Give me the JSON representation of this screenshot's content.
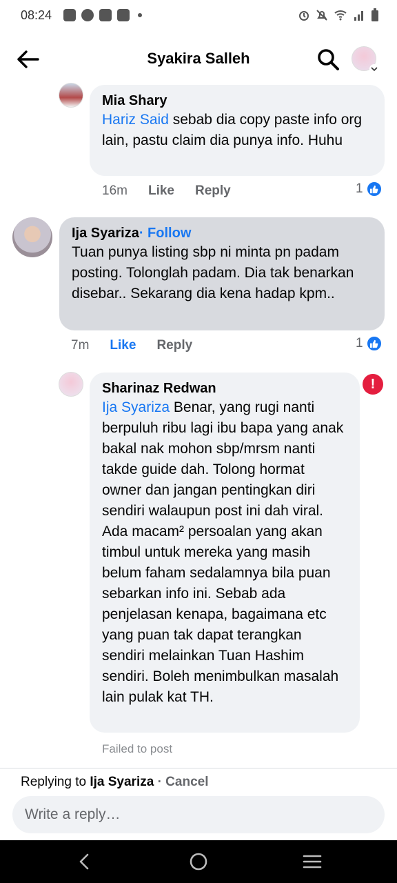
{
  "status": {
    "time": "08:24"
  },
  "header": {
    "title": "Syakira Salleh"
  },
  "comments": [
    {
      "author": "Mia Shary",
      "mention": "Hariz Said",
      "text": " sebab dia copy paste info org lain, pastu claim dia punya info. Huhu",
      "time": "16m",
      "like_label": "Like",
      "reply_label": "Reply",
      "reactions": "1"
    },
    {
      "author": "Ija Syariza",
      "follow_label": "· Follow",
      "text": "Tuan punya listing sbp ni minta pn padam posting. Tolonglah padam. Dia tak benarkan disebar.. Sekarang dia kena hadap kpm..",
      "time": "7m",
      "like_label": "Like",
      "reply_label": "Reply",
      "reactions": "1"
    },
    {
      "author": "Sharinaz Redwan",
      "mention": "Ija Syariza",
      "text": " Benar, yang rugi nanti berpuluh ribu lagi ibu bapa yang anak bakal nak mohon sbp/mrsm nanti takde guide dah. Tolong hormat owner dan jangan pentingkan diri sendiri walaupun post ini dah viral. Ada macam² persoalan yang akan timbul untuk mereka yang masih belum faham sedalamnya bila puan sebarkan info ini. Sebab ada penjelasan kenapa, bagaimana etc yang puan tak dapat terangkan sendiri melainkan Tuan Hashim sendiri. Boleh menimbulkan masalah lain pulak kat TH.",
      "status": "Failed to post"
    }
  ],
  "composer": {
    "replying_prefix": "Replying to ",
    "replying_to": "Ija Syariza",
    "cancel_label": " · Cancel",
    "placeholder": "Write a reply…"
  }
}
